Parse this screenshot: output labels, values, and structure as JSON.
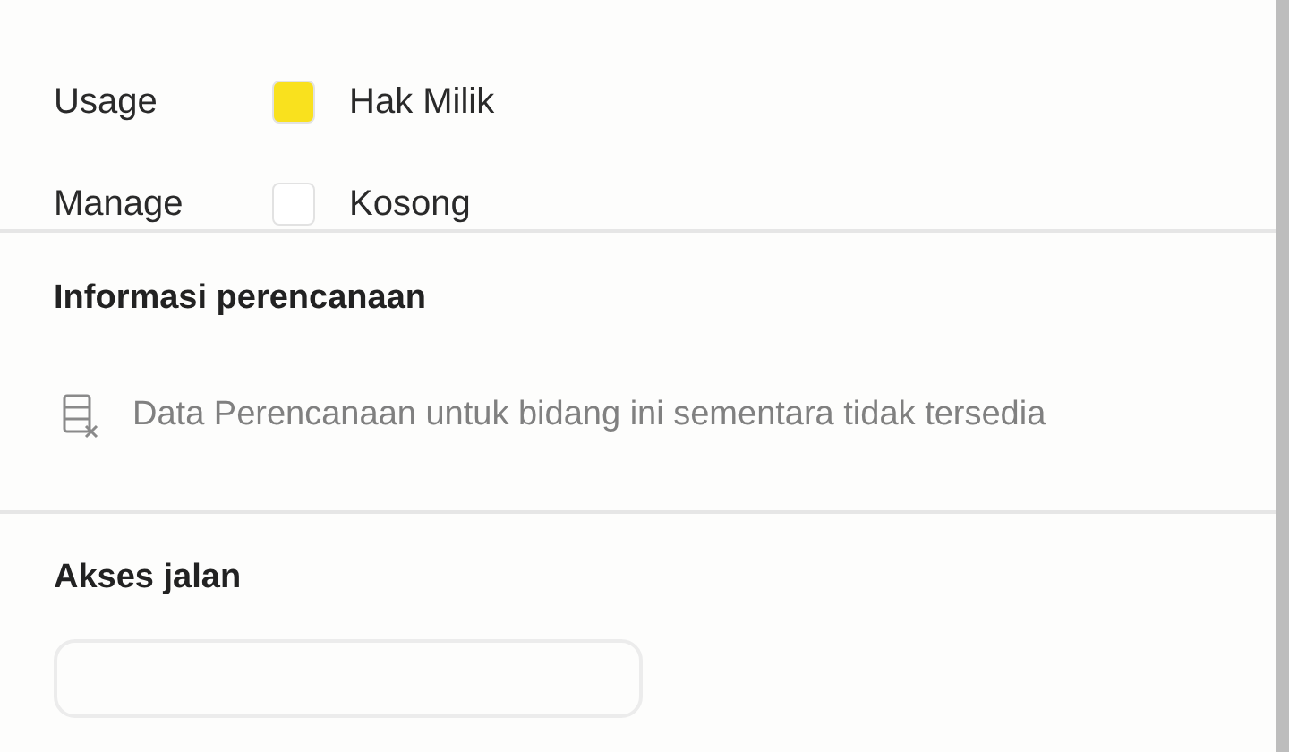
{
  "legend": [
    {
      "label": "Usage",
      "value": "Hak Milik",
      "color": "#f9e11e"
    },
    {
      "label": "Manage",
      "value": "Kosong",
      "color": "#ffffff"
    }
  ],
  "planning": {
    "title": "Informasi perencanaan",
    "message": "Data Perencanaan untuk bidang ini sementara tidak tersedia"
  },
  "road_access": {
    "title": "Akses jalan"
  }
}
